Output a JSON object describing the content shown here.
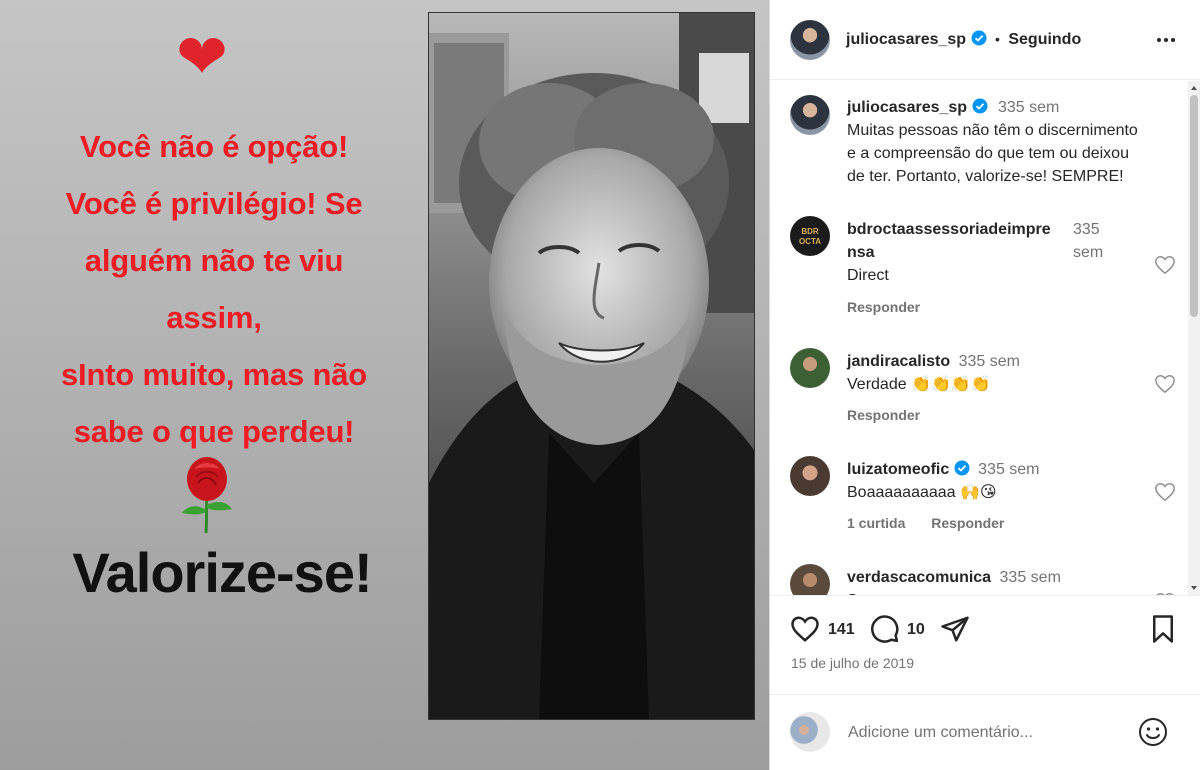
{
  "media": {
    "heart_emoji": "❤",
    "quote_lines": [
      "Você não é opção!",
      "Você é privilégio! Se",
      "alguém não te viu",
      "assim,",
      "sInto muito, mas não",
      "sabe o que perdeu!"
    ],
    "rose_emoji": "🌹",
    "headline": "Valorize-se!",
    "colors": {
      "quote": "#ee1b24",
      "headline": "#111111"
    }
  },
  "header": {
    "username": "juliocasares_sp",
    "verified_icon": "verified-badge-icon",
    "separator": "•",
    "follow_status": "Seguindo",
    "more_icon": "more-options-icon"
  },
  "caption": {
    "username": "juliocasares_sp",
    "time": "335 sem",
    "text_lines": [
      "Muitas pessoas não têm o discernimento",
      "e a compreensão do que tem ou deixou",
      "de ter. Portanto, valorize-se! SEMPRE!"
    ]
  },
  "comments": [
    {
      "username_line1": "bdroctaassessoriadeimpre",
      "username_line2": "nsa",
      "time_line1": "335",
      "time_line2": "sem",
      "text": "Direct",
      "reply": "Responder",
      "avatar_text": "BDR OCTA"
    },
    {
      "username": "jandiracalisto",
      "time": "335 sem",
      "text": "Verdade 👏👏👏👏",
      "reply": "Responder"
    },
    {
      "username": "luizatomeofic",
      "verified": true,
      "time": "335 sem",
      "text": "Boaaaaaaaaaa 🙌😘",
      "likes": "1 curtida",
      "reply": "Responder"
    },
    {
      "username": "verdascacomunica",
      "time": "335 sem",
      "text": "S"
    }
  ],
  "actions": {
    "like_count": "141",
    "comment_count": "10",
    "date": "15 de julho de 2019",
    "icons": [
      "like-heart-icon",
      "comment-bubble-icon",
      "share-paper-plane-icon",
      "save-bookmark-icon"
    ]
  },
  "add_comment": {
    "placeholder": "Adicione um comentário...",
    "emoji_icon": "emoji-smiley-icon"
  }
}
